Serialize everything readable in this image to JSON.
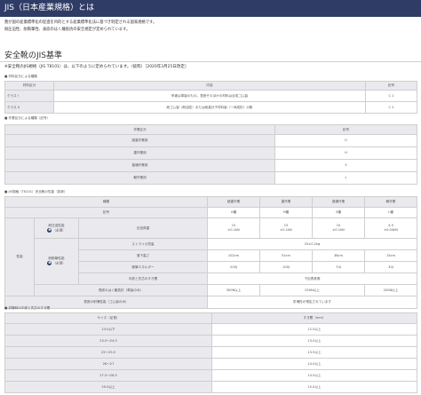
{
  "header": {
    "title": "JIS（日本産業規格）とは"
  },
  "intro": {
    "line1": "我が国の産業標準化の促進を目的とする産業標準化法に基づき制定される国家規格です。",
    "line2": "耐圧迫性、耐衝撃性、表底のはく離抵抗の安全規定が定められています。"
  },
  "section": {
    "title": "安全靴のJIS基準",
    "standard_note": "※安全靴のJIS規格（JIS T8101）は、以下のように定められています。（抜粋）［2020年3月25日改定］"
  },
  "table1": {
    "caption": "■ 材料区分による種類",
    "headers": [
      "材料区分",
      "内容",
      "記号"
    ],
    "rows": [
      [
        "クラス I",
        "甲被は革製のもの。表底そのほかの材料は合成ゴム製",
        "C 1"
      ],
      [
        "クラス II",
        "総ゴム製（耐油性）または総高分子材料製（一体成形）の靴",
        "C 2"
      ]
    ]
  },
  "table2": {
    "caption": "■ 作業区分による種類（記号）",
    "headers": [
      "作業区分",
      "記号"
    ],
    "rows": [
      [
        "超重作業用",
        "U"
      ],
      [
        "重作業用",
        "H"
      ],
      [
        "普通作業用",
        "S"
      ],
      [
        "軽作業用",
        "L"
      ]
    ]
  },
  "table3": {
    "caption": "■ JIS規格（T8101）安全靴の性能（抜粋）",
    "kind_label": "種類",
    "symbol_label": "記号",
    "kinds": [
      "超重作業",
      "重作業",
      "普通作業",
      "軽作業"
    ],
    "symbols": [
      "U種",
      "H種",
      "S種",
      "L種"
    ],
    "performance_label": "性能",
    "toe_label": "耐圧迫性能",
    "badge": "❶",
    "required_label": "（必須）",
    "compression_label": "圧迫荷重",
    "compression": [
      [
        "15",
        "±0.1kN"
      ],
      [
        "15",
        "±0.1kN"
      ],
      [
        "10",
        "±0.1kN"
      ],
      [
        "4.5",
        "±0.04kN"
      ]
    ],
    "impact_label": "耐衝撃性能",
    "striker_label": "ストライカ質量",
    "striker_value": "20±0.2kg",
    "drop_label": "落下高さ",
    "drop": [
      "102cm",
      "51cm",
      "36cm",
      "15cm"
    ],
    "energy_label": "衝撃エネルギー",
    "energy": [
      "200J",
      "100J",
      "70J",
      "30J"
    ],
    "gap_label": "中底と先芯のすき間",
    "gap_value": "下記表参照",
    "peel_label": "表底のはく離抵抗（革製のみ）",
    "peel": [
      "300N以上",
      "250N以上",
      "200N以上"
    ],
    "sole_label": "表底の耐滑性能（ゴム製のみ）",
    "sole_value": "防滑性が規定されています"
  },
  "table4": {
    "caption": "■ 試験時の中底と先芯のすき間",
    "headers": [
      "サイズ（足長）",
      "すき間（mm）"
    ],
    "rows": [
      [
        "23.0以下",
        "12.5以上"
      ],
      [
        "23.5〜24.5",
        "13.0以上"
      ],
      [
        "25〜25.5",
        "13.5以上"
      ],
      [
        "26〜27",
        "14.0以上"
      ],
      [
        "27.5〜28.5",
        "14.5以上"
      ],
      [
        "29.0以上",
        "15.0以上"
      ]
    ]
  },
  "colors": {
    "header_bg": "#2f3c66",
    "label_bg": "#e9e9ee",
    "border": "#cfcfcf"
  }
}
